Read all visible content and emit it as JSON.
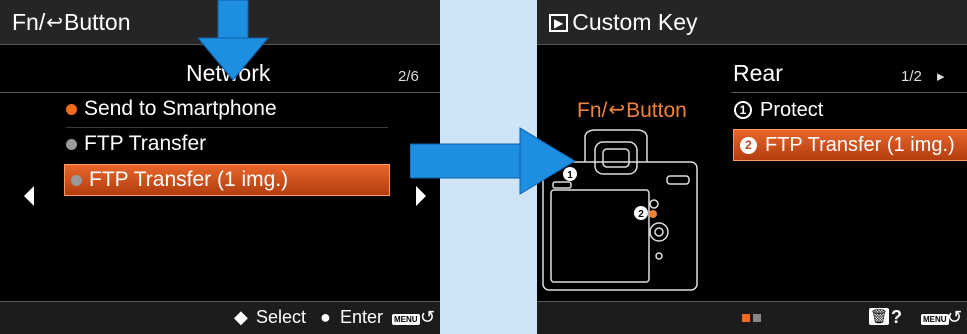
{
  "left_screen": {
    "title_prefix": "Fn/",
    "title_icon": "↩",
    "title_suffix": "Button",
    "section": "Network",
    "page": "2/6",
    "items": [
      {
        "label": "Send to Smartphone",
        "dot_color": "#f26a1b"
      },
      {
        "label": "FTP Transfer",
        "dot_color": "#9a9a9a"
      },
      {
        "label": "FTP Transfer (1 img.)",
        "dot_color": "#9a9a9a",
        "selected": true
      }
    ],
    "footer": {
      "select_icon": "◆",
      "select_label": "Select",
      "enter_icon": "●",
      "enter_label": "Enter",
      "menu_label": "MENU",
      "back_icon": "↺"
    }
  },
  "right_screen": {
    "title_icon": "▶",
    "title": "Custom Key",
    "section": "Rear",
    "page": "1/2",
    "page_arrow": "▸",
    "key_label_prefix": "Fn/",
    "key_label_icon": "↩",
    "key_label_suffix": "Button",
    "options": [
      {
        "num": "1",
        "label": "Protect"
      },
      {
        "num": "2",
        "label": "FTP Transfer (1 img.)",
        "selected": true
      }
    ],
    "camera_markers": [
      "1",
      "2"
    ],
    "footer": {
      "trash_icon": "🗑",
      "help": "?",
      "menu_label": "MENU",
      "back_icon": "↺"
    }
  },
  "colors": {
    "accent": "#e8662a",
    "arrow_blue": "#1e8fe0",
    "background": "#cfe4f6"
  }
}
